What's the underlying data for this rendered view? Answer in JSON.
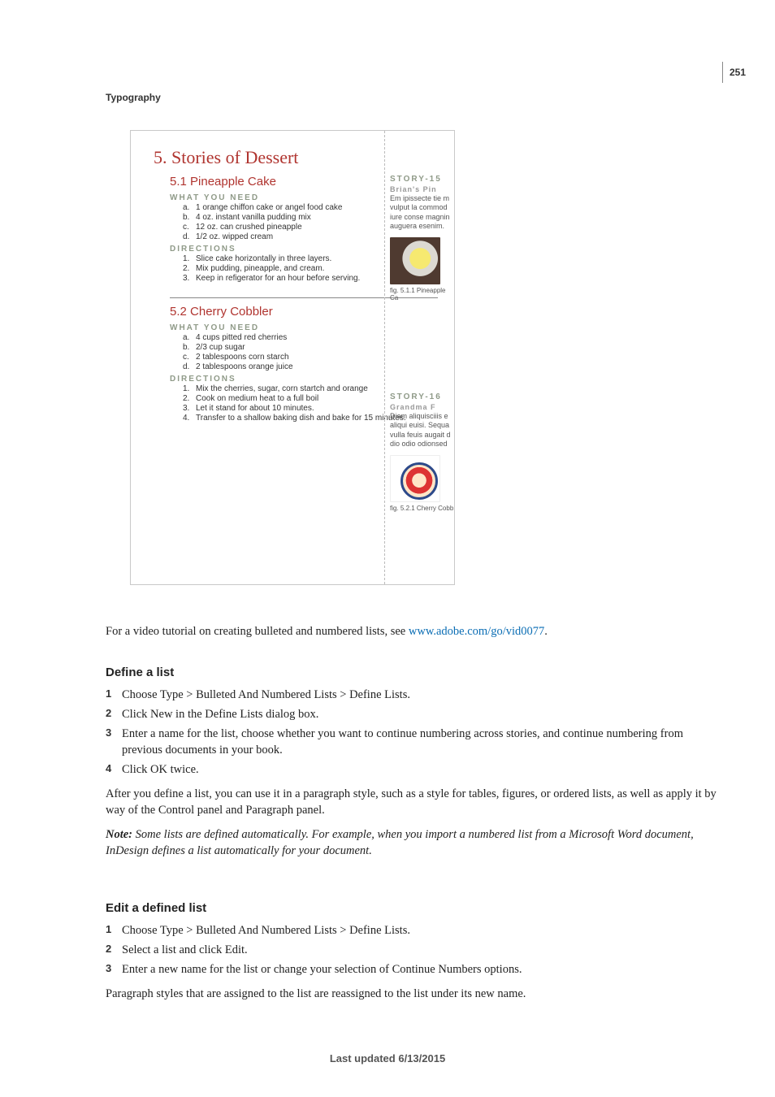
{
  "page_number": "251",
  "chapter": "Typography",
  "figure": {
    "title": "5.  Stories of Dessert",
    "sections": [
      {
        "heading": "5.1  Pineapple Cake",
        "need_label": "WHAT YOU NEED",
        "need": [
          {
            "m": "a.",
            "t": "1 orange chiffon cake or angel food cake"
          },
          {
            "m": "b.",
            "t": "4 oz. instant vanilla pudding mix"
          },
          {
            "m": "c.",
            "t": "12 oz. can crushed pineapple"
          },
          {
            "m": "d.",
            "t": "1/2 oz. wipped cream"
          }
        ],
        "dir_label": "DIRECTIONS",
        "dir": [
          {
            "m": "1.",
            "t": "Slice cake horizontally in three layers."
          },
          {
            "m": "2.",
            "t": "Mix pudding, pineapple, and cream."
          },
          {
            "m": "3.",
            "t": "Keep in refigerator for an hour before serving."
          }
        ],
        "side": {
          "story": "STORY-15",
          "auth": "Brian's Pin",
          "blurb": "Em ipissecte tie m vulput la commod iure conse magnin auguera esenim.",
          "cap": "fig. 5.1.1 Pineapple Ca"
        }
      },
      {
        "heading": "5.2  Cherry Cobbler",
        "need_label": "WHAT YOU NEED",
        "need": [
          {
            "m": "a.",
            "t": "4 cups pitted red cherries"
          },
          {
            "m": "b.",
            "t": "2/3 cup sugar"
          },
          {
            "m": "c.",
            "t": "2 tablespoons corn starch"
          },
          {
            "m": "d.",
            "t": "2 tablespoons orange juice"
          }
        ],
        "dir_label": "DIRECTIONS",
        "dir": [
          {
            "m": "1.",
            "t": "Mix the cherries, sugar, corn startch and orange"
          },
          {
            "m": "2.",
            "t": "Cook on medium heat to a full boil"
          },
          {
            "m": "3.",
            "t": "Let it stand for about 10 minutes."
          },
          {
            "m": "4.",
            "t": "Transfer to a shallow baking dish and bake for 15 minutes."
          }
        ],
        "side": {
          "story": "STORY-16",
          "auth": "Grandma F",
          "blurb": "Diam aliquisciiis e aliqui euisi. Sequa vulla feuis augait d dio odio odionsed",
          "cap": "fig. 5.2.1 Cherry Cobb"
        }
      }
    ]
  },
  "intro_pre": "For a video tutorial on creating bulleted and numbered lists, see ",
  "intro_link": "www.adobe.com/go/vid0077",
  "intro_post": ".",
  "define": {
    "heading": "Define a list",
    "steps": [
      "Choose Type > Bulleted And Numbered Lists > Define Lists.",
      "Click New in the Define Lists dialog box.",
      "Enter a name for the list, choose whether you want to continue numbering across stories, and continue numbering from previous documents in your book.",
      "Click OK twice."
    ],
    "after": "After you define a list, you can use it in a paragraph style, such as a style for tables, figures, or ordered lists, as well as apply it by way of the Control panel and Paragraph panel.",
    "note_label": "Note:",
    "note": " Some lists are defined automatically. For example, when you import a numbered list from a Microsoft Word document, InDesign defines a list automatically for your document."
  },
  "edit": {
    "heading": "Edit a defined list",
    "steps": [
      "Choose Type > Bulleted And Numbered Lists > Define Lists.",
      "Select a list and click Edit.",
      "Enter a new name for the list or change your selection of Continue Numbers options."
    ],
    "after": "Paragraph styles that are assigned to the list are reassigned to the list under its new name."
  },
  "footer": "Last updated 6/13/2015",
  "step_numbers": [
    "1",
    "2",
    "3",
    "4"
  ]
}
